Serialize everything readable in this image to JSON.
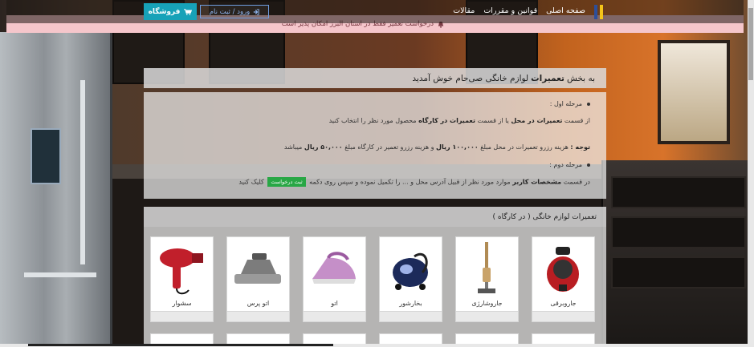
{
  "nav": {
    "links": [
      "صفحه اصلی",
      "قوانین و مقررات",
      "مقالات"
    ],
    "login_label": "ورود / ثبت نام",
    "shop_label": "فروشگاه"
  },
  "alert": {
    "text": "درخواست تعمیر فقط در استان البرز امکان پذیر است"
  },
  "welcome": {
    "prefix": "به بخش",
    "bold": "تعمیرات",
    "suffix": "لوازم خانگی صی‌حام خوش آمدید",
    "step1_title": "مرحله اول :",
    "step1_a": "از قسمت",
    "step1_b": "تعمیرات در محل",
    "step1_c": "یا از قسمت",
    "step1_d": "تعمیرات در کارگاه",
    "step1_e": "محصول مورد نظر را انتخاب کنید",
    "note_label": "توجه :",
    "note_a": "هزینه رزرو تعمیرات در محل مبلغ",
    "note_b": "۱۰۰,۰۰۰ ریال",
    "note_c": "و هزینه رزرو تعمیر در کارگاه مبلغ",
    "note_d": "۵۰,۰۰۰ ریال",
    "note_e": "میباشد",
    "step2_title": "مرحله دوم :",
    "step2_a": "در قسمت",
    "step2_b": "مشخصات کاربر",
    "step2_c": "موارد مورد نظر از قبیل آدرس محل و ... را تکمیل نموده و سپس روی دکمه",
    "step2_badge": "ثبت درخواست",
    "step2_d": "کلیک کنید"
  },
  "repairs": {
    "title": "تعمیرات لوازم خانگی ( در کارگاه )",
    "products": [
      {
        "name": "جاروبرقی",
        "icon": "vacuum-cleaner"
      },
      {
        "name": "جاروشارژی",
        "icon": "cordless-vacuum"
      },
      {
        "name": "بخارشور",
        "icon": "steam-cleaner"
      },
      {
        "name": "اتو",
        "icon": "steam-iron"
      },
      {
        "name": "اتو پرس",
        "icon": "press-iron"
      },
      {
        "name": "سشوار",
        "icon": "hair-dryer"
      }
    ]
  },
  "colors": {
    "accent": "#17a2b8",
    "alert_bg": "#f5c6cb",
    "badge": "#28a745"
  }
}
